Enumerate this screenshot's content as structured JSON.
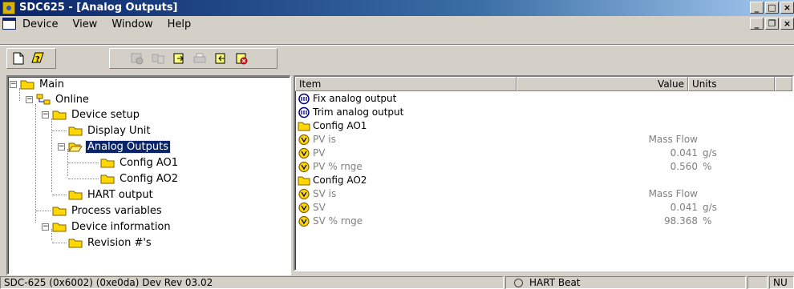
{
  "window": {
    "title": "SDC625 - [Analog Outputs]",
    "minimize": "_",
    "maximize": "□",
    "close": "×"
  },
  "menubar": {
    "items": [
      "Device",
      "View",
      "Window",
      "Help"
    ],
    "mdi_minimize": "_",
    "mdi_restore": "❐",
    "mdi_close": "×"
  },
  "toolbar": {
    "buttons": [
      "new-icon",
      "help-icon",
      "properties-icon",
      "compare-icon",
      "export-icon",
      "print-icon",
      "import-icon",
      "close-device-icon"
    ]
  },
  "tree": {
    "nodes": [
      {
        "label": "Main",
        "expander": "−",
        "icon": "folder-icon"
      },
      {
        "label": "Online",
        "expander": "−",
        "icon": "network-icon"
      },
      {
        "label": "Device setup",
        "expander": "−",
        "icon": "folder-icon"
      },
      {
        "label": "Display Unit",
        "expander": "",
        "icon": "folder-icon"
      },
      {
        "label": "Analog Outputs",
        "expander": "−",
        "icon": "folder-open-icon",
        "selected": true
      },
      {
        "label": "Config AO1",
        "expander": "",
        "icon": "folder-icon"
      },
      {
        "label": "Config AO2",
        "expander": "",
        "icon": "folder-icon"
      },
      {
        "label": "HART output",
        "expander": "",
        "icon": "folder-icon"
      },
      {
        "label": "Process variables",
        "expander": "",
        "icon": "folder-icon"
      },
      {
        "label": "Device information",
        "expander": "−",
        "icon": "folder-icon"
      },
      {
        "label": "Revision #'s",
        "expander": "",
        "icon": "folder-icon"
      }
    ]
  },
  "list": {
    "headers": {
      "item": "Item",
      "value": "Value",
      "units": "Units"
    },
    "rows": [
      {
        "icon": "method-icon",
        "item": "Fix analog output",
        "value": "",
        "units": "",
        "kind": "method"
      },
      {
        "icon": "method-icon",
        "item": "Trim analog output",
        "value": "",
        "units": "",
        "kind": "method"
      },
      {
        "icon": "folder-icon",
        "item": "Config AO1",
        "value": "",
        "units": "",
        "kind": "folder"
      },
      {
        "icon": "variable-icon",
        "item": "PV is",
        "value": "Mass Flow",
        "units": "",
        "kind": "var"
      },
      {
        "icon": "variable-icon",
        "item": "PV",
        "value": "0.041",
        "units": "g/s",
        "kind": "var"
      },
      {
        "icon": "variable-icon",
        "item": "PV % rnge",
        "value": "0.560",
        "units": "%",
        "kind": "var"
      },
      {
        "icon": "folder-icon",
        "item": "Config AO2",
        "value": "",
        "units": "",
        "kind": "folder"
      },
      {
        "icon": "variable-icon",
        "item": "SV is",
        "value": "Mass Flow",
        "units": "",
        "kind": "var"
      },
      {
        "icon": "variable-icon",
        "item": "SV",
        "value": "0.041",
        "units": "g/s",
        "kind": "var"
      },
      {
        "icon": "variable-icon",
        "item": "SV % rnge",
        "value": "98.368",
        "units": "%",
        "kind": "var"
      }
    ]
  },
  "status": {
    "device": "SDC-625   (0x6002)  (0xe0da) Dev Rev 03.02",
    "hart": "HART Beat",
    "num": "NU"
  }
}
